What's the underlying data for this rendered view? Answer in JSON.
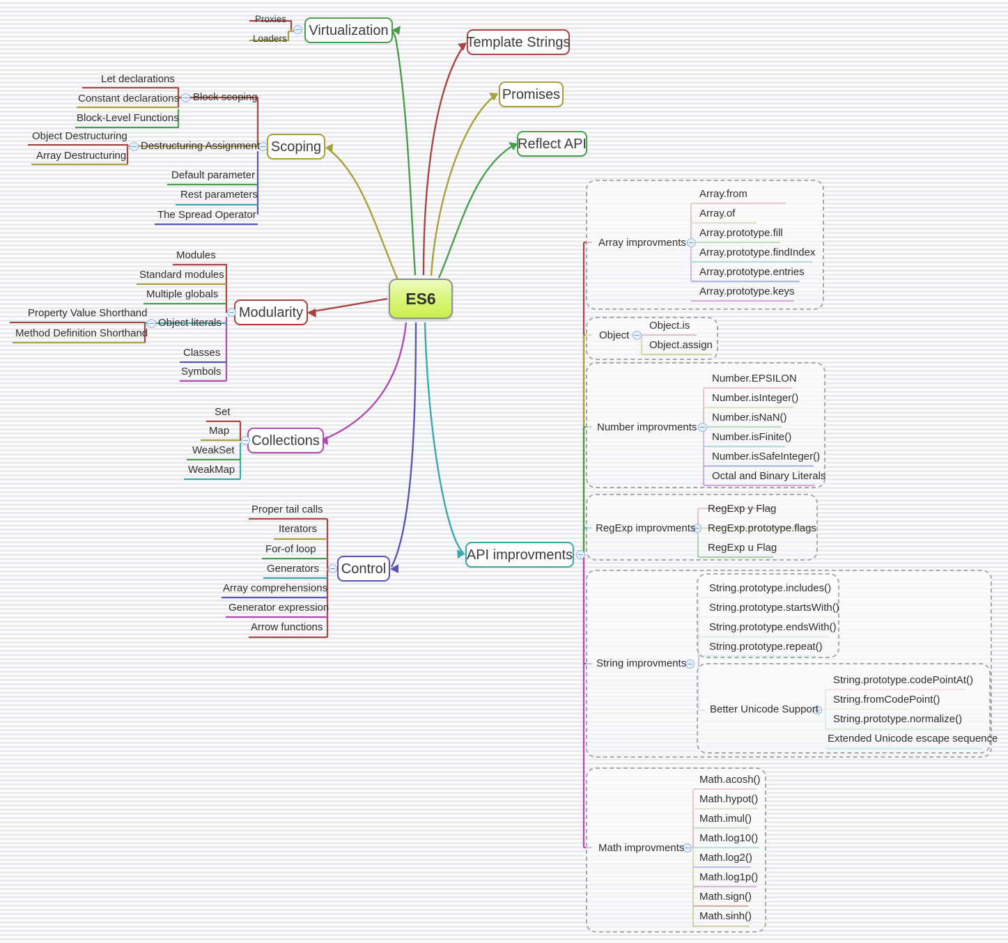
{
  "root": {
    "label": "ES6"
  },
  "palette": {
    "red": "#a94442",
    "olive": "#a8a03a",
    "green": "#4a9d4a",
    "teal": "#3aa8a8",
    "blue": "#5a55b0",
    "purple": "#b04ab0",
    "frame": "#a9a9a9"
  },
  "main_branches": [
    {
      "label": "Virtualization",
      "color": "#4a9d4a"
    },
    {
      "label": "Template Strings",
      "color": "#a94442"
    },
    {
      "label": "Promises",
      "color": "#a8a03a"
    },
    {
      "label": "Reflect API",
      "color": "#4a9d4a"
    },
    {
      "label": "Scoping",
      "color": "#a8a03a"
    },
    {
      "label": "Modularity",
      "color": "#a94442"
    },
    {
      "label": "Collections",
      "color": "#b04ab0"
    },
    {
      "label": "Control",
      "color": "#5a55b0"
    },
    {
      "label": "API improvments",
      "color": "#3aa8a8"
    }
  ],
  "virtualization": {
    "label": "Virtualization",
    "children": [
      {
        "label": "Proxies",
        "color": "#a94442"
      },
      {
        "label": "Loaders",
        "color": "#a8a03a"
      }
    ]
  },
  "template_strings": {
    "label": "Template Strings"
  },
  "promises": {
    "label": "Promises"
  },
  "reflect_api": {
    "label": "Reflect API"
  },
  "scoping": {
    "label": "Scoping",
    "children": [
      {
        "label": "Block scoping",
        "color": "#a94442",
        "has_badge": true,
        "children": [
          {
            "label": "Let declarations",
            "color": "#a94442"
          },
          {
            "label": "Constant declarations",
            "color": "#a8a03a"
          },
          {
            "label": "Block-Level Functions",
            "color": "#4a9d4a"
          }
        ]
      },
      {
        "label": "Destructuring Assignment",
        "color": "#a8a03a",
        "has_badge": true,
        "children": [
          {
            "label": "Object Destructuring",
            "color": "#a94442"
          },
          {
            "label": "Array Destructuring",
            "color": "#a8a03a"
          }
        ]
      },
      {
        "label": "Default parameter",
        "color": "#4a9d4a"
      },
      {
        "label": "Rest parameters",
        "color": "#3aa8a8"
      },
      {
        "label": "The Spread Operator",
        "color": "#5a55b0"
      }
    ]
  },
  "modularity": {
    "label": "Modularity",
    "children": [
      {
        "label": "Modules",
        "color": "#a94442"
      },
      {
        "label": "Standard modules",
        "color": "#a8a03a"
      },
      {
        "label": "Multiple globals",
        "color": "#4a9d4a"
      },
      {
        "label": "Object literals",
        "color": "#3aa8a8",
        "has_badge": true,
        "children": [
          {
            "label": "Property Value Shorthand",
            "color": "#a94442"
          },
          {
            "label": "Method Definition Shorthand",
            "color": "#a8a03a"
          }
        ]
      },
      {
        "label": "Classes",
        "color": "#5a55b0"
      },
      {
        "label": "Symbols",
        "color": "#b04ab0"
      }
    ]
  },
  "collections": {
    "label": "Collections",
    "children": [
      {
        "label": "Set",
        "color": "#a94442"
      },
      {
        "label": "Map",
        "color": "#a8a03a"
      },
      {
        "label": "WeakSet",
        "color": "#4a9d4a"
      },
      {
        "label": "WeakMap",
        "color": "#3aa8a8"
      }
    ]
  },
  "control": {
    "label": "Control",
    "children": [
      {
        "label": "Proper tail calls",
        "color": "#a94442"
      },
      {
        "label": "Iterators",
        "color": "#a8a03a"
      },
      {
        "label": "For-of loop",
        "color": "#4a9d4a"
      },
      {
        "label": "Generators",
        "color": "#3aa8a8"
      },
      {
        "label": "Array comprehensions",
        "color": "#5a55b0"
      },
      {
        "label": "Generator expression",
        "color": "#b04ab0"
      },
      {
        "label": "Arrow functions",
        "color": "#a94442"
      }
    ]
  },
  "api_improvements": {
    "label": "API improvments",
    "groups": [
      {
        "label": "Array improvments",
        "color": "#a94442",
        "children": [
          {
            "label": "Array.from",
            "color": "#a94442"
          },
          {
            "label": "Array.of",
            "color": "#a8a03a"
          },
          {
            "label": "Array.prototype.fill",
            "color": "#4a9d4a"
          },
          {
            "label": "Array.prototype.findIndex",
            "color": "#3aa8a8"
          },
          {
            "label": "Array.prototype.entries",
            "color": "#5a55b0"
          },
          {
            "label": "Array.prototype.keys",
            "color": "#b04ab0"
          }
        ]
      },
      {
        "label": "Object",
        "color": "#a8a03a",
        "children": [
          {
            "label": "Object.is",
            "color": "#a94442"
          },
          {
            "label": "Object.assign",
            "color": "#a8a03a"
          }
        ]
      },
      {
        "label": "Number improvments",
        "color": "#4a9d4a",
        "children": [
          {
            "label": "Number.EPSILON",
            "color": "#a94442"
          },
          {
            "label": "Number.isInteger()",
            "color": "#a8a03a"
          },
          {
            "label": "Number.isNaN()",
            "color": "#4a9d4a"
          },
          {
            "label": "Number.isFinite()",
            "color": "#3aa8a8"
          },
          {
            "label": "Number.isSafeInteger()",
            "color": "#5a55b0"
          },
          {
            "label": "Octal and Binary Literals",
            "color": "#b04ab0"
          }
        ]
      },
      {
        "label": "RegExp improvments",
        "color": "#3aa8a8",
        "children": [
          {
            "label": "RegExp y Flag",
            "color": "#a94442"
          },
          {
            "label": "RegExp.prototype.flags",
            "color": "#a8a03a"
          },
          {
            "label": "RegExp u Flag",
            "color": "#4a9d4a"
          }
        ]
      },
      {
        "label": "String improvments",
        "color": "#5a55b0",
        "children": [
          {
            "label": "String.prototype.includes()",
            "color": "#a94442"
          },
          {
            "label": "String.prototype.startsWith()",
            "color": "#a8a03a"
          },
          {
            "label": "String.prototype.endsWith()",
            "color": "#4a9d4a"
          },
          {
            "label": "String.prototype.repeat()",
            "color": "#3aa8a8"
          }
        ],
        "sub_group": {
          "label": "Better Unicode Support",
          "color": "#5a55b0",
          "children": [
            {
              "label": "String.prototype.codePointAt()",
              "color": "#a94442"
            },
            {
              "label": "String.fromCodePoint()",
              "color": "#a8a03a"
            },
            {
              "label": "String.prototype.normalize()",
              "color": "#4a9d4a"
            },
            {
              "label": "Extended Unicode escape sequence",
              "color": "#3aa8a8"
            }
          ]
        }
      },
      {
        "label": "Math improvments",
        "color": "#b04ab0",
        "children": [
          {
            "label": "Math.acosh()",
            "color": "#a94442"
          },
          {
            "label": "Math.hypot()",
            "color": "#a8a03a"
          },
          {
            "label": "Math.imul()",
            "color": "#4a9d4a"
          },
          {
            "label": "Math.log10()",
            "color": "#3aa8a8"
          },
          {
            "label": "Math.log2()",
            "color": "#5a55b0"
          },
          {
            "label": "Math.log1p()",
            "color": "#b04ab0"
          },
          {
            "label": "Math.sign()",
            "color": "#a94442"
          },
          {
            "label": "Math.sinh()",
            "color": "#a8a03a"
          }
        ]
      }
    ]
  }
}
